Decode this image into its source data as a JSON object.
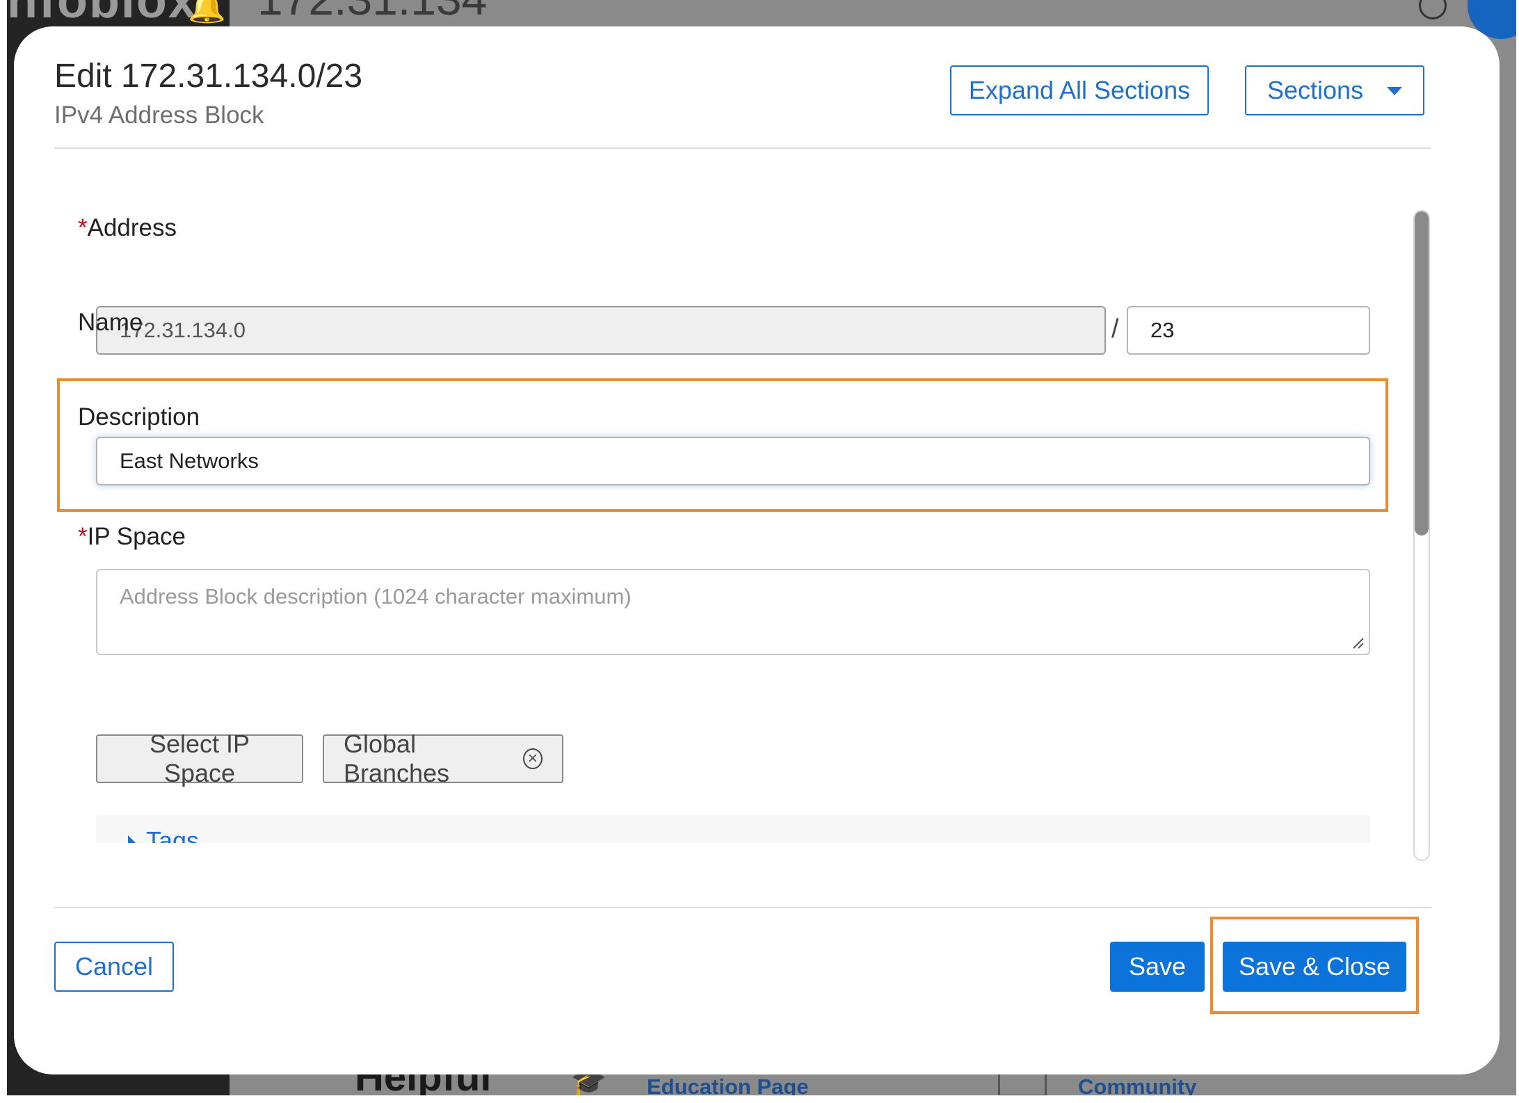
{
  "background": {
    "logo_text": "nfoblox",
    "breadcrumb": "172.31.134",
    "bottom_heading": "Helpful",
    "links": {
      "education": "Education Page",
      "community": "Community"
    }
  },
  "modal": {
    "title": "Edit 172.31.134.0/23",
    "subtitle": "IPv4 Address Block",
    "expand_all_label": "Expand All Sections",
    "sections_label": "Sections"
  },
  "form": {
    "address": {
      "required_marker": "*",
      "label": "Address",
      "value": "172.31.134.0",
      "separator": "/",
      "cidr": "23"
    },
    "name": {
      "label": "Name",
      "value": "East Networks"
    },
    "description": {
      "label": "Description",
      "placeholder": "Address Block description (1024 character maximum)",
      "value": ""
    },
    "ip_space": {
      "required_marker": "*",
      "label": "IP Space",
      "select_label": "Select IP Space",
      "selected_chip": "Global Branches",
      "chip_remove_glyph": "×"
    },
    "tags": {
      "label": "Tags"
    }
  },
  "footer": {
    "cancel_label": "Cancel",
    "save_label": "Save",
    "save_close_label": "Save & Close"
  },
  "colors": {
    "accent": "#0b73d9",
    "required": "#d0021b",
    "highlight": "#f08a2e"
  }
}
